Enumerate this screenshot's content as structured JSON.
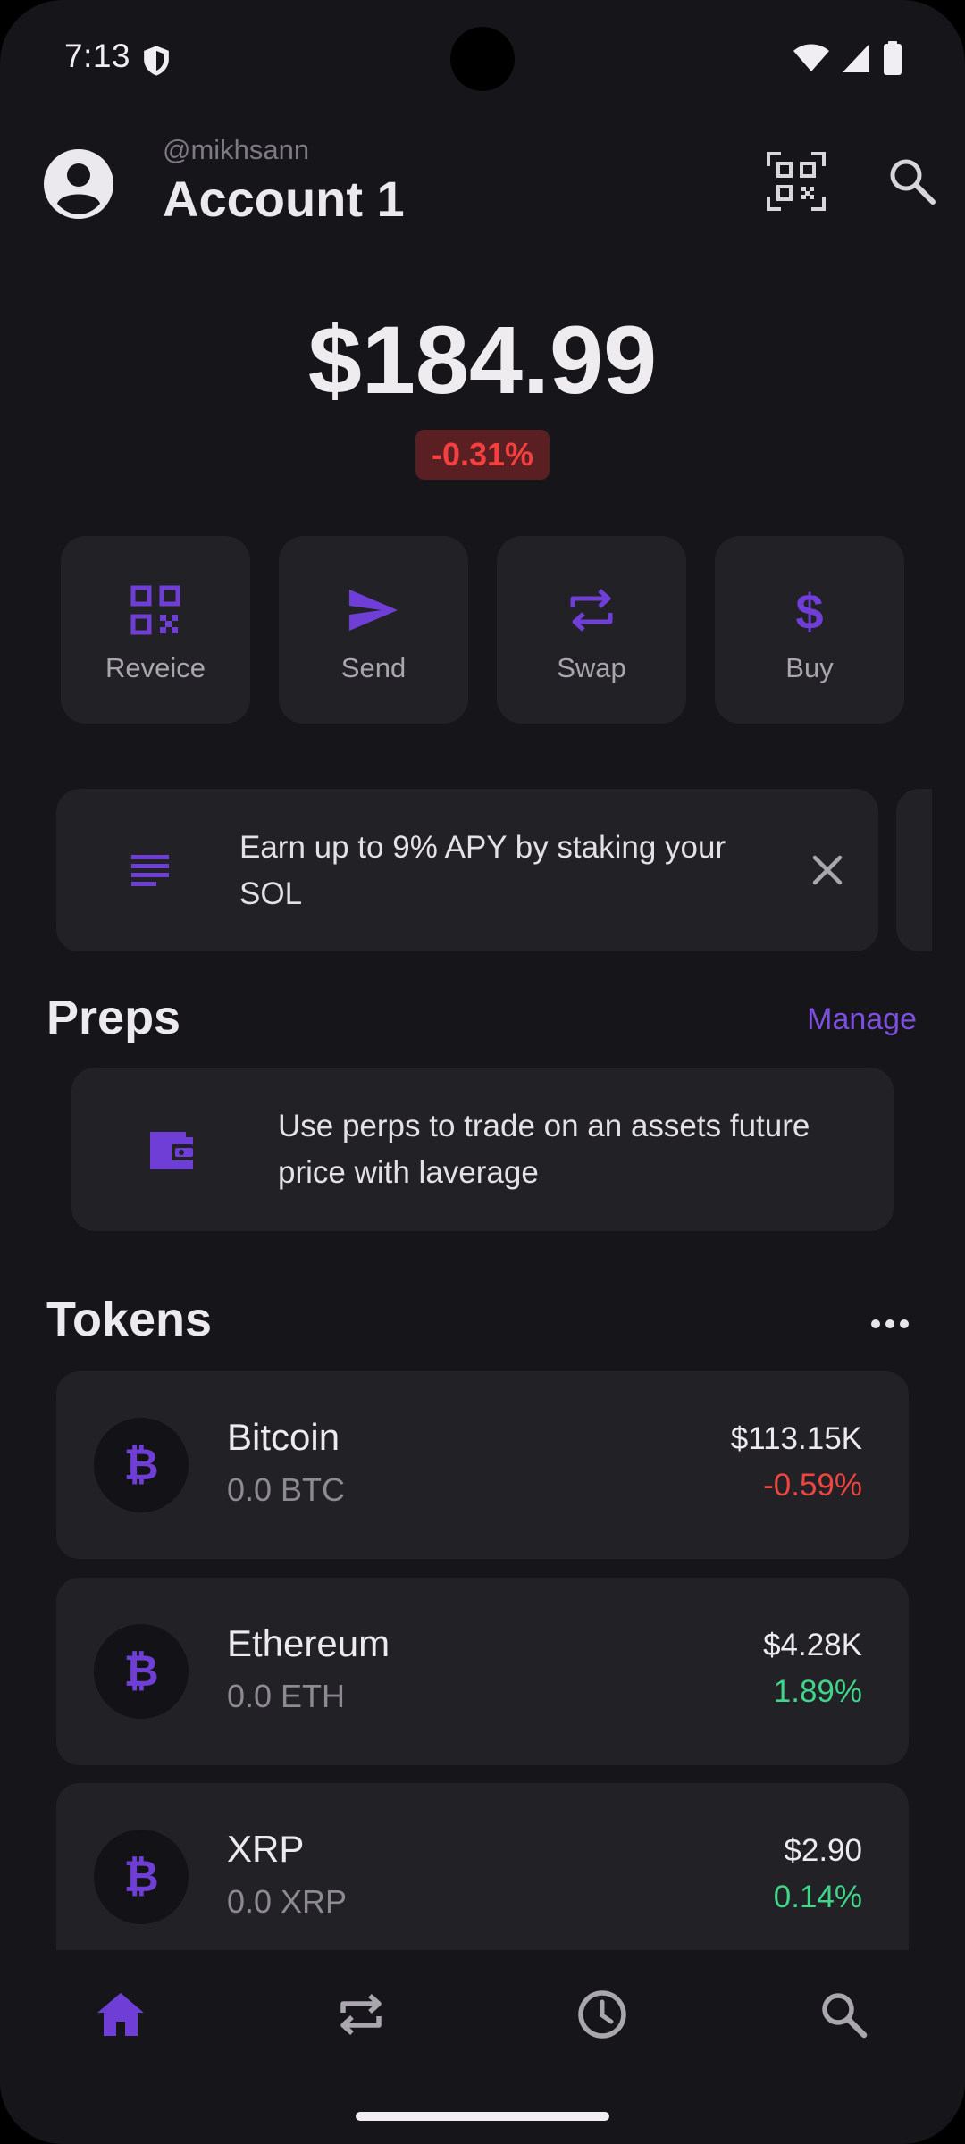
{
  "status_bar": {
    "time": "7:13"
  },
  "header": {
    "handle": "@mikhsann",
    "account_name": "Account 1"
  },
  "balance": {
    "total": "$184.99",
    "change": "-0.31%"
  },
  "actions": [
    {
      "label": "Reveice",
      "icon": "qr-grid-icon"
    },
    {
      "label": "Send",
      "icon": "send-icon"
    },
    {
      "label": "Swap",
      "icon": "swap-icon"
    },
    {
      "label": "Buy",
      "icon": "dollar-icon"
    }
  ],
  "promo": {
    "text": "Earn up to 9% APY by staking your SOL"
  },
  "perps": {
    "title": "Preps",
    "manage_label": "Manage",
    "card_text": "Use perps to trade on an assets future price with laverage"
  },
  "tokens": {
    "title": "Tokens",
    "items": [
      {
        "name": "Bitcoin",
        "amount": "0.0 BTC",
        "price": "$113.15K",
        "change": "-0.59%",
        "direction": "down"
      },
      {
        "name": "Ethereum",
        "amount": "0.0 ETH",
        "price": "$4.28K",
        "change": "1.89%",
        "direction": "up"
      },
      {
        "name": "XRP",
        "amount": "0.0 XRP",
        "price": "$2.90",
        "change": "0.14%",
        "direction": "up"
      }
    ]
  },
  "bottom_nav": [
    {
      "icon": "home-icon",
      "active": true
    },
    {
      "icon": "swap-icon",
      "active": false
    },
    {
      "icon": "history-icon",
      "active": false
    },
    {
      "icon": "search-icon",
      "active": false
    }
  ],
  "colors": {
    "background": "#161519",
    "card": "#222126",
    "accent": "#7c4fe0",
    "negative": "#f04440",
    "positive": "#3fd68a"
  }
}
